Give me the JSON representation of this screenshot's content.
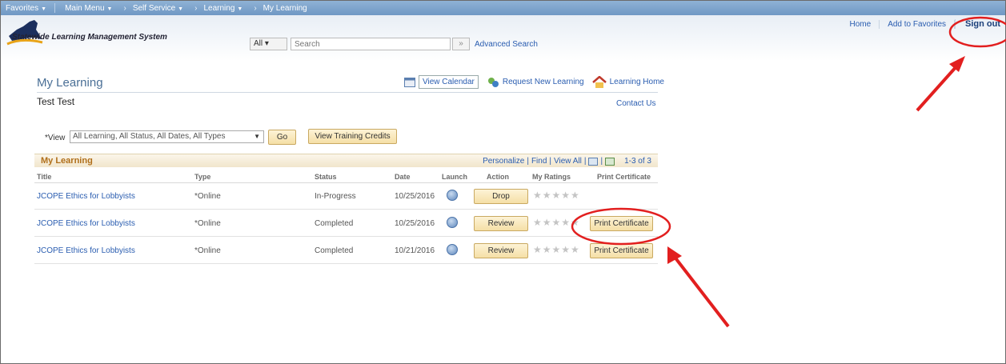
{
  "topnav": {
    "favorites": "Favorites",
    "main_menu": "Main Menu",
    "self_service": "Self Service",
    "learning": "Learning",
    "my_learning": "My Learning"
  },
  "header": {
    "logo_text": "Statewide Learning Management System",
    "search_scope": "All",
    "search_placeholder": "Search",
    "advanced_search": "Advanced Search",
    "home": "Home",
    "add_to_favorites": "Add to Favorites",
    "sign_out": "Sign out"
  },
  "page": {
    "title": "My Learning",
    "person": "Test Test",
    "view_calendar": "View Calendar",
    "request_new_learning": "Request New Learning",
    "learning_home": "Learning Home",
    "contact_us": "Contact Us",
    "view_label": "*View",
    "view_value": "All Learning, All Status, All Dates, All Types",
    "go": "Go",
    "view_training_credits": "View Training Credits"
  },
  "grid": {
    "title": "My Learning",
    "personalize": "Personalize",
    "find": "Find",
    "view_all": "View All",
    "count": "1-3 of 3",
    "columns": [
      "Title",
      "Type",
      "Status",
      "Date",
      "Launch",
      "Action",
      "My Ratings",
      "Print Certificate"
    ],
    "rows": [
      {
        "title": "JCOPE Ethics for Lobbyists",
        "type": "*Online",
        "status": "In-Progress",
        "date": "10/25/2016",
        "action": "Drop",
        "certificate": ""
      },
      {
        "title": "JCOPE Ethics for Lobbyists",
        "type": "*Online",
        "status": "Completed",
        "date": "10/25/2016",
        "action": "Review",
        "certificate": "Print Certificate"
      },
      {
        "title": "JCOPE Ethics for Lobbyists",
        "type": "*Online",
        "status": "Completed",
        "date": "10/21/2016",
        "action": "Review",
        "certificate": "Print Certificate"
      }
    ],
    "stars": "★★★★★"
  },
  "colors": {
    "nav_bar": "#7aa0ca",
    "link": "#2a5db0",
    "button": "#f5dfa6",
    "annotation": "#e21f1f"
  }
}
